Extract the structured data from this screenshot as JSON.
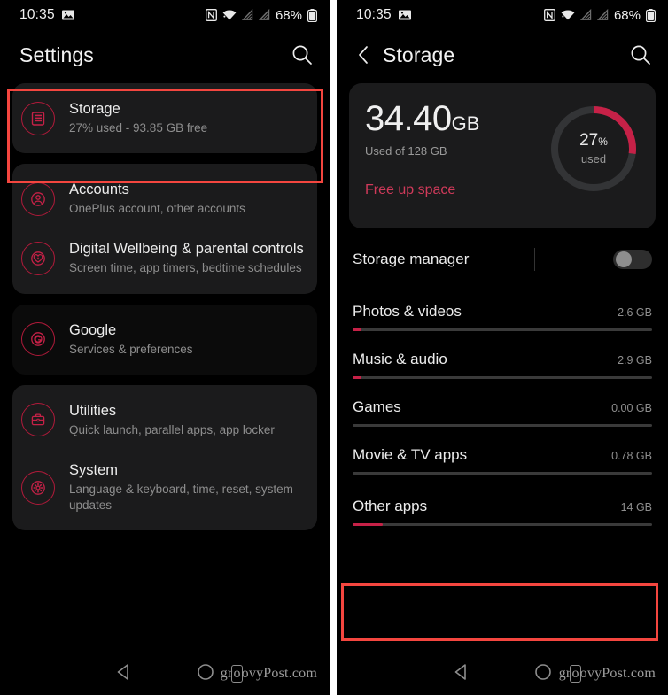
{
  "accent": "#c62147",
  "highlight_color": "#f4463f",
  "card_bg": "#1b1b1c",
  "statusbar": {
    "time": "10:35",
    "battery_percent": "68%",
    "icons": [
      "screenshot-icon",
      "nfc-icon",
      "wifi-icon",
      "signal-empty-icon",
      "signal-empty-icon",
      "battery-icon"
    ]
  },
  "left_phone": {
    "appbar": {
      "title": "Settings",
      "search_icon": "search-icon"
    },
    "groups": [
      {
        "highlighted": true,
        "items": [
          {
            "icon": "storage-icon",
            "title": "Storage",
            "subtitle": "27% used - 93.85 GB free"
          }
        ]
      },
      {
        "highlighted": false,
        "items": [
          {
            "icon": "account-icon",
            "title": "Accounts",
            "subtitle": "OnePlus account, other accounts"
          },
          {
            "icon": "wellbeing-heart-icon",
            "title": "Digital Wellbeing & parental controls",
            "subtitle": "Screen time, app timers, bedtime schedules"
          }
        ]
      },
      {
        "highlighted": false,
        "flat": true,
        "items": [
          {
            "icon": "google-icon",
            "title": "Google",
            "subtitle": "Services & preferences"
          }
        ]
      },
      {
        "highlighted": false,
        "items": [
          {
            "icon": "utilities-briefcase-icon",
            "title": "Utilities",
            "subtitle": "Quick launch, parallel apps, app locker"
          },
          {
            "icon": "system-gear-icon",
            "title": "System",
            "subtitle": "Language & keyboard, time, reset, system updates"
          }
        ]
      }
    ]
  },
  "right_phone": {
    "appbar": {
      "back_icon": "chevron-left-icon",
      "title": "Storage",
      "search_icon": "search-icon"
    },
    "usage": {
      "amount": "34.40",
      "unit": "GB",
      "of_label": "Used of 128 GB",
      "free_up_label": "Free up space",
      "percent_value": "27",
      "percent_symbol": "%",
      "percent_caption": "used",
      "percent_number": 27
    },
    "storage_manager": {
      "label": "Storage manager",
      "toggle_state": "off"
    },
    "categories": [
      {
        "name": "Photos & videos",
        "size": "2.6 GB",
        "fill_percent": 3,
        "highlighted": false
      },
      {
        "name": "Music & audio",
        "size": "2.9 GB",
        "fill_percent": 3,
        "highlighted": false
      },
      {
        "name": "Games",
        "size": "0.00 GB",
        "fill_percent": 0,
        "highlighted": false
      },
      {
        "name": "Movie & TV apps",
        "size": "0.78 GB",
        "fill_percent": 0,
        "highlighted": false
      },
      {
        "name": "Other apps",
        "size": "14 GB",
        "fill_percent": 10,
        "highlighted": true
      }
    ]
  },
  "navbar": {
    "back_icon": "triangle-back-icon",
    "home_icon": "circle-home-icon"
  },
  "watermark": {
    "prefix": "gr",
    "boxed": "o",
    "suffix": "ovyPost.com"
  }
}
